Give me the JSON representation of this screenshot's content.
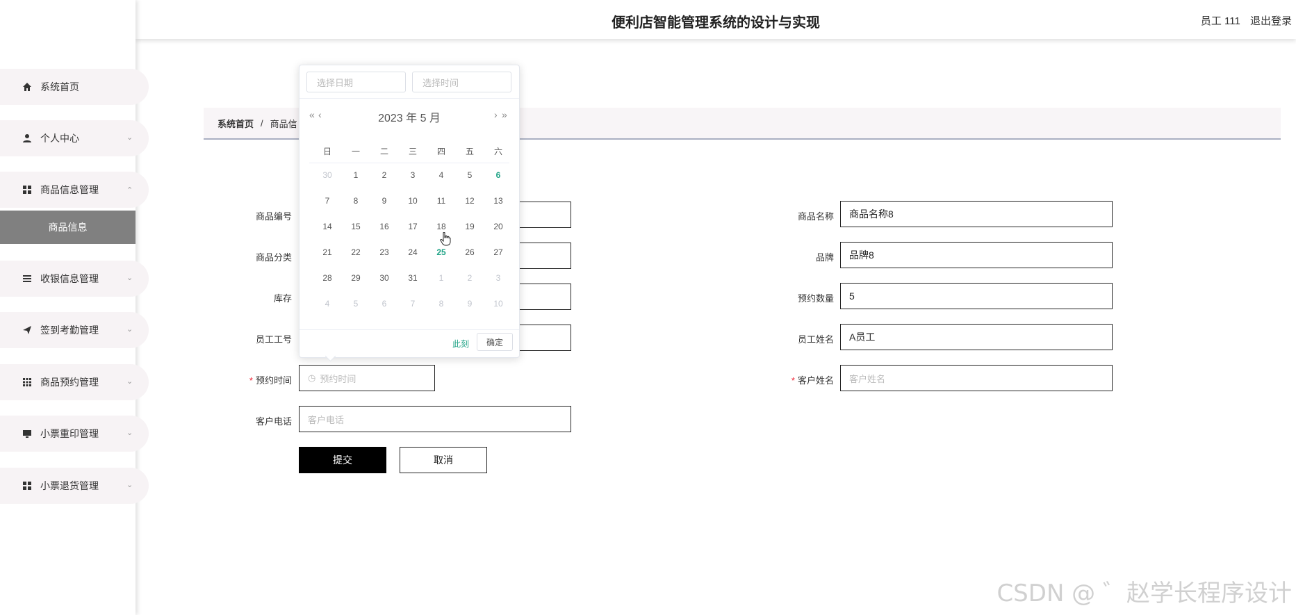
{
  "header": {
    "title": "便利店智能管理系统的设计与实现",
    "user_label": "员工 111",
    "logout_label": "退出登录"
  },
  "sidebar": {
    "items": [
      {
        "label": "系统首页",
        "icon": "home-icon"
      },
      {
        "label": "个人中心",
        "icon": "user-icon"
      },
      {
        "label": "商品信息管理",
        "icon": "grid-icon"
      },
      {
        "label": "收银信息管理",
        "icon": "list-icon"
      },
      {
        "label": "签到考勤管理",
        "icon": "send-icon"
      },
      {
        "label": "商品预约管理",
        "icon": "apps-icon"
      },
      {
        "label": "小票重印管理",
        "icon": "monitor-icon"
      },
      {
        "label": "小票退货管理",
        "icon": "grid-icon"
      }
    ],
    "active_sub": "商品信息"
  },
  "breadcrumb": {
    "home": "系统首页",
    "separator": "/",
    "current": "商品信"
  },
  "form": {
    "labels": {
      "code": "商品编号",
      "category": "商品分类",
      "stock": "库存",
      "emp_no": "员工工号",
      "reserve_time": "预约时间",
      "phone": "客户电话",
      "name": "商品名称",
      "brand": "品牌",
      "reserve_qty": "预约数量",
      "emp_name": "员工姓名",
      "cust_name": "客户姓名"
    },
    "values": {
      "name": "商品名称8",
      "brand": "品牌8",
      "reserve_qty": "5",
      "emp_name": "A员工"
    },
    "placeholders": {
      "reserve_time": "预约时间",
      "phone": "客户电话",
      "cust_name": "客户姓名"
    },
    "required_mark": "*",
    "submit_label": "提交",
    "cancel_label": "取消"
  },
  "picker": {
    "date_placeholder": "选择日期",
    "time_placeholder": "选择时间",
    "nav_prev_year": "«",
    "nav_prev_month": "‹",
    "nav_next_month": "›",
    "nav_next_year": "»",
    "title": "2023 年  5 月",
    "weekdays": [
      "日",
      "一",
      "二",
      "三",
      "四",
      "五",
      "六"
    ],
    "weeks": [
      [
        "30",
        "1",
        "2",
        "3",
        "4",
        "5",
        "6"
      ],
      [
        "7",
        "8",
        "9",
        "10",
        "11",
        "12",
        "13"
      ],
      [
        "14",
        "15",
        "16",
        "17",
        "18",
        "19",
        "20"
      ],
      [
        "21",
        "22",
        "23",
        "24",
        "25",
        "26",
        "27"
      ],
      [
        "28",
        "29",
        "30",
        "31",
        "1",
        "2",
        "3"
      ],
      [
        "4",
        "5",
        "6",
        "7",
        "8",
        "9",
        "10"
      ]
    ],
    "now_label": "此刻",
    "confirm_label": "确定"
  },
  "watermark": "CSDN @ ゛赵学长程序设计",
  "colors": {
    "accent_green": "#1fa386",
    "sidebar_active": "#808080",
    "required": "#e23"
  }
}
